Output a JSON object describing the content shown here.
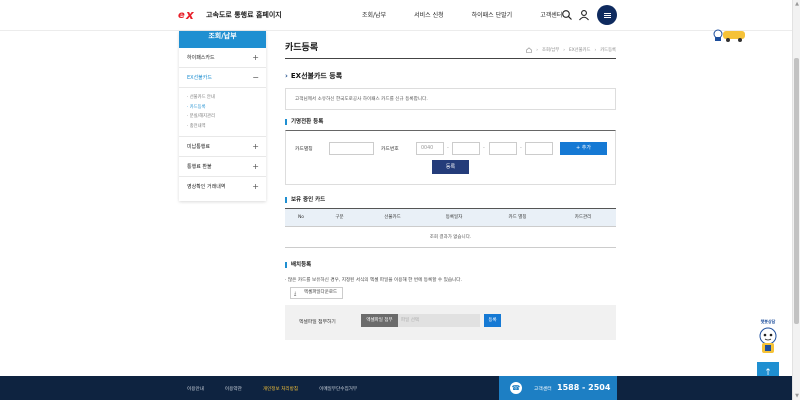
{
  "header": {
    "logo_text": "고속도로 통행료 홈페이지",
    "nav": [
      "조회/납부",
      "서비스 신청",
      "하이패스 단말기",
      "고객센터"
    ],
    "icons": [
      "search-icon",
      "user-icon",
      "menu-icon"
    ]
  },
  "sidebar": {
    "title": "조회/납부",
    "items": [
      {
        "label": "하이패스카드",
        "toggle": "+"
      },
      {
        "label": "EX선불카드",
        "toggle": "−"
      }
    ],
    "subitems": [
      "· 선불카드 안내",
      "· 카드등록",
      "· 분실/해지관리",
      "· 충전내역"
    ],
    "items_after": [
      {
        "label": "미납통행료",
        "toggle": "+"
      },
      {
        "label": "통행료 환불",
        "toggle": "+"
      },
      {
        "label": "영상확인 거래내역",
        "toggle": "+"
      }
    ]
  },
  "main": {
    "page_title": "카드등록",
    "breadcrumb": [
      "조회/납부",
      "EX선불카드",
      "카드등록"
    ],
    "section_title": "EX선불카드 등록",
    "notice": "고객님께서 소유하신 한국도로공사 하이패스 카드를 신규 등록합니다.",
    "individual": {
      "title": "기명전환 등록",
      "nickname_label": "카드별칭",
      "cardno_label": "카드번호",
      "card_prefix": "0040",
      "dash": "-",
      "add_button": "+ 추가",
      "register_button": "등록"
    },
    "table": {
      "title": "보유 중인 카드",
      "columns": [
        "No",
        "구분",
        "선불카드",
        "등록일자",
        "카드 별칭",
        "카드관리"
      ],
      "empty": "조회 결과가 없습니다."
    },
    "bulk": {
      "title": "배치등록",
      "note": "· 많은 카드를 보유하신 경우, 지정된 서식의 엑셀 파일을 이용해 한 번에 등록할 수 있습니다.",
      "excel_button": "엑셀파일다운로드",
      "attach_label": "엑셀파일 첨부하기",
      "attach_button": "엑셀파일 첨부",
      "file_placeholder": "파일 선택",
      "upload_button": "등록"
    }
  },
  "footer": {
    "links": [
      "이용안내",
      "이용약관",
      "개인정보 처리방침",
      "이메일무단수집거부"
    ],
    "callcenter_label": "고객센터",
    "callcenter_number": "1588 - 2504"
  },
  "floating": {
    "chat_label": "챗봇상담",
    "top_icon": "↑"
  },
  "colors": {
    "accent": "#1f8fd1",
    "brand_red": "#e8202a",
    "navy": "#0e2340",
    "button_blue": "#1579d4"
  }
}
